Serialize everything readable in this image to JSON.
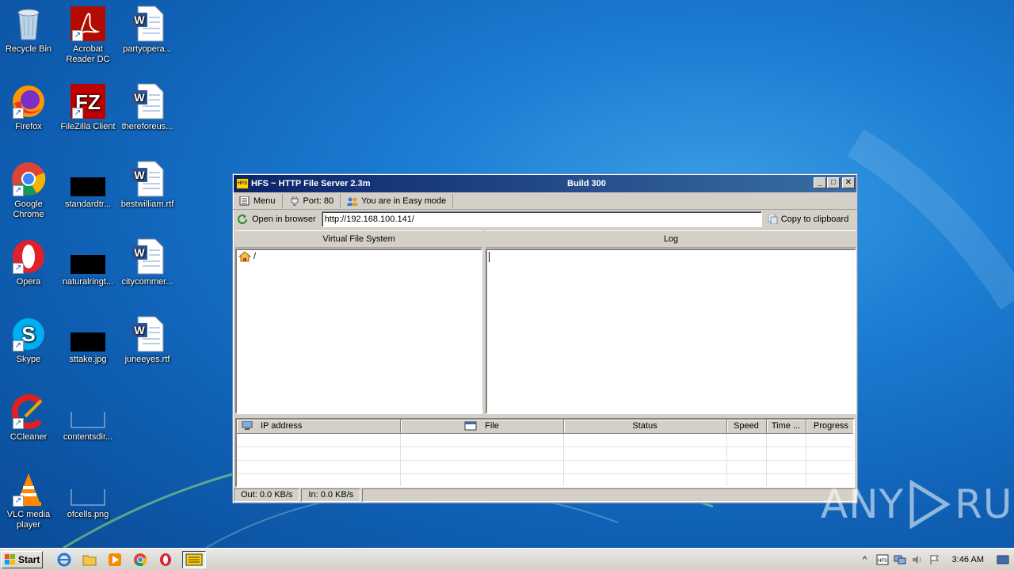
{
  "desktop": {
    "icons": [
      {
        "label": "Recycle Bin",
        "kind": "recycle-bin-icon"
      },
      {
        "label": "Acrobat Reader DC",
        "kind": "acrobat-icon"
      },
      {
        "label": "partyopera...",
        "kind": "word-doc-icon"
      },
      {
        "label": "Firefox",
        "kind": "firefox-icon"
      },
      {
        "label": "FileZilla Client",
        "kind": "filezilla-icon"
      },
      {
        "label": "thereforeus...",
        "kind": "word-doc-icon"
      },
      {
        "label": "Google Chrome",
        "kind": "chrome-icon"
      },
      {
        "label": "standardtr...",
        "kind": "black-image-icon"
      },
      {
        "label": "bestwilliam.rtf",
        "kind": "word-doc-icon"
      },
      {
        "label": "Opera",
        "kind": "opera-icon"
      },
      {
        "label": "naturalringt...",
        "kind": "black-image-icon"
      },
      {
        "label": "citycommer...",
        "kind": "word-doc-icon"
      },
      {
        "label": "Skype",
        "kind": "skype-icon"
      },
      {
        "label": "sttake.jpg",
        "kind": "black-image-icon"
      },
      {
        "label": "juneeyes.rtf",
        "kind": "word-doc-icon"
      },
      {
        "label": "CCleaner",
        "kind": "ccleaner-icon"
      },
      {
        "label": "contentsdir...",
        "kind": "blank-image-icon"
      },
      {
        "label": "VLC media player",
        "kind": "vlc-icon"
      },
      {
        "label": "ofcells.png",
        "kind": "blank-image-icon"
      }
    ]
  },
  "window": {
    "title": "HFS ~ HTTP File Server 2.3m",
    "build": "Build 300",
    "controls": {
      "minimize": "_",
      "maximize": "□",
      "close": "✕"
    },
    "toolbar": {
      "menu": "Menu",
      "port": "Port: 80",
      "mode": "You are in Easy mode"
    },
    "url_bar": {
      "open_label": "Open in browser",
      "url": "http://192.168.100.141/",
      "copy_label": "Copy to clipboard"
    },
    "vfs": {
      "header": "Virtual File System",
      "root": "/"
    },
    "log": {
      "header": "Log"
    },
    "connections": {
      "columns": [
        "IP address",
        "File",
        "Status",
        "Speed",
        "Time ...",
        "Progress"
      ]
    },
    "status": {
      "out": "Out: 0.0 KB/s",
      "in": "In: 0.0 KB/s"
    }
  },
  "watermark": {
    "left": "ANY",
    "right": "RUN"
  },
  "taskbar": {
    "start": "Start",
    "clock": "3:46 AM",
    "tray_app": "HFS"
  }
}
